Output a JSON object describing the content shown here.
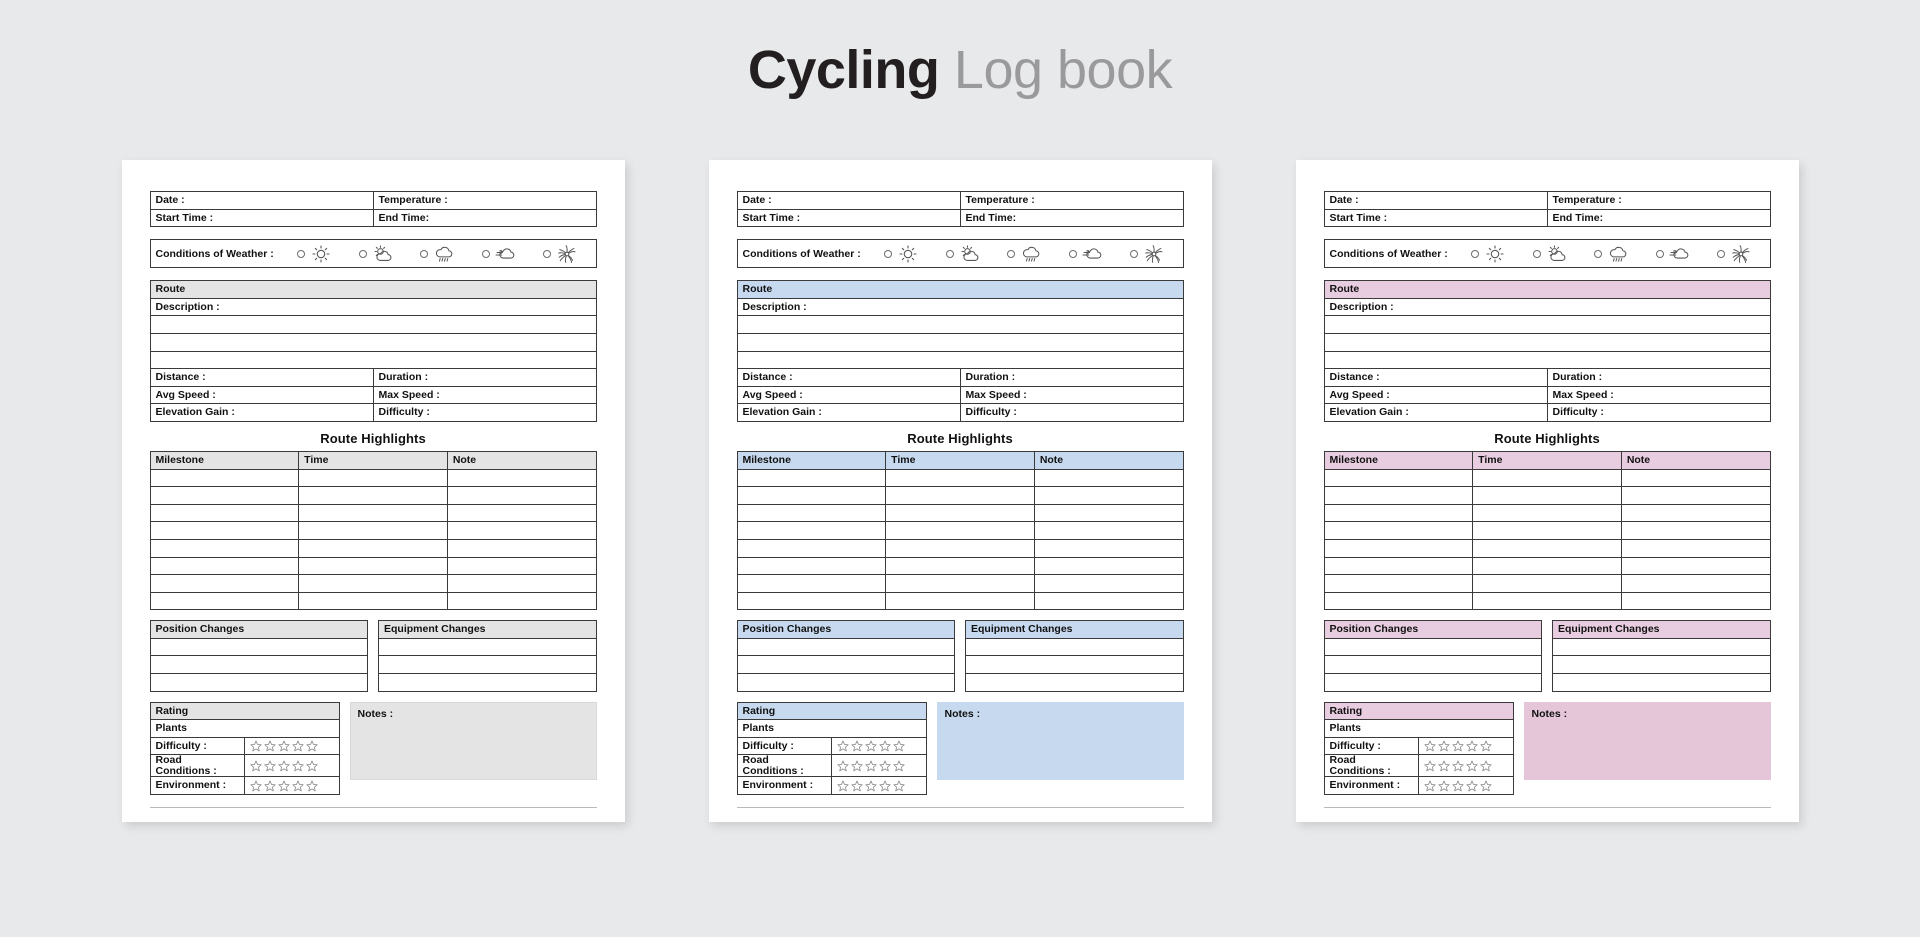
{
  "title": {
    "strong": "Cycling",
    "light": "Log book"
  },
  "accents": {
    "gray": "#e4e4e4",
    "blue": "#c6d9ef",
    "pink": "#e8cde0"
  },
  "notes_fill": {
    "gray": "#e4e4e4",
    "blue": "#c6d9ef",
    "pink": "#e4c6d8"
  },
  "card": {
    "top_fields": [
      {
        "left": "Date :",
        "right": "Temperature :"
      },
      {
        "left": "Start Time :",
        "right": "End Time:"
      }
    ],
    "weather": {
      "label": "Conditions of  Weather :",
      "options": [
        {
          "icon": "sun-icon"
        },
        {
          "icon": "partly-cloudy-icon"
        },
        {
          "icon": "rain-cloud-icon"
        },
        {
          "icon": "windy-cloud-icon"
        },
        {
          "icon": "sunburst-icon"
        }
      ]
    },
    "route": {
      "header": "Route",
      "description_label": "Description :",
      "description_blank_rows": 3,
      "stats": [
        {
          "left": "Distance :",
          "right": "Duration :"
        },
        {
          "left": "Avg Speed :",
          "right": "Max Speed :"
        },
        {
          "left": "Elevation Gain :",
          "right": "Difficulty :"
        }
      ]
    },
    "highlights": {
      "title": "Route Highlights",
      "columns": [
        "Milestone",
        "Time",
        "Note"
      ],
      "blank_rows": 8
    },
    "changes": {
      "position_header": "Position Changes",
      "equipment_header": "Equipment Changes",
      "blank_rows": 3
    },
    "rating": {
      "header": "Rating",
      "subheader": "Plants",
      "rows": [
        {
          "label": "Difficulty :",
          "stars": 5
        },
        {
          "label": "Road Conditions :",
          "stars": 5
        },
        {
          "label": "Environment :",
          "stars": 5
        }
      ]
    },
    "notes": {
      "label": "Notes :"
    }
  },
  "cards": [
    {
      "theme": "gray"
    },
    {
      "theme": "blue"
    },
    {
      "theme": "pink"
    }
  ]
}
